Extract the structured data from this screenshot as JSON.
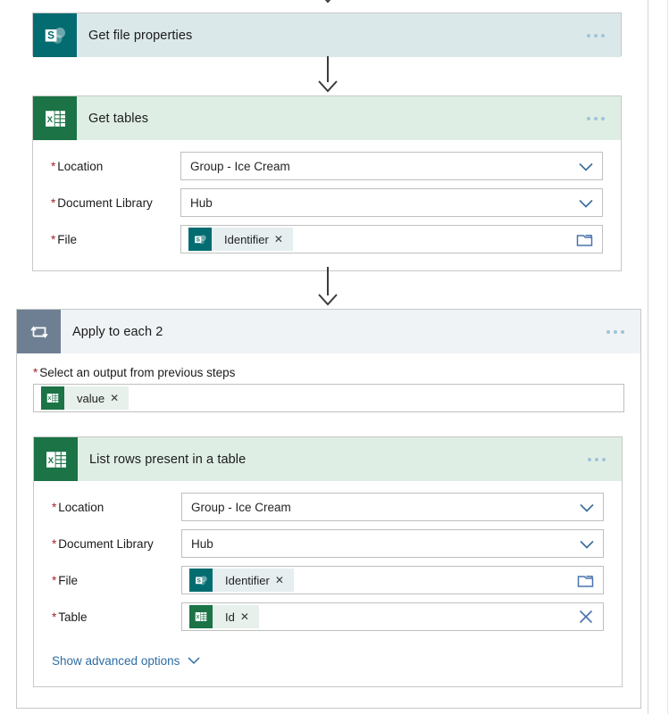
{
  "flow": {
    "steps": [
      {
        "id": "get-file-properties",
        "title": "Get file properties",
        "connector": "sharepoint",
        "icon": "sharepoint-icon",
        "menu_label": "...",
        "fields": []
      },
      {
        "id": "get-tables",
        "title": "Get tables",
        "connector": "excel",
        "icon": "excel-icon",
        "menu_label": "...",
        "fields": [
          {
            "label": "Location",
            "required": true,
            "type": "dropdown",
            "value": "Group - Ice Cream",
            "trailing_icon": "chevron-down-icon"
          },
          {
            "label": "Document Library",
            "required": true,
            "type": "dropdown",
            "value": "Hub",
            "trailing_icon": "chevron-down-icon"
          },
          {
            "label": "File",
            "required": true,
            "type": "token",
            "token": {
              "text": "Identifier",
              "icon": "sharepoint-icon",
              "remove_label": "✕"
            },
            "trailing_icon": "folder-picker-icon"
          }
        ]
      }
    ],
    "loop": {
      "id": "apply-to-each-2",
      "title": "Apply to each 2",
      "icon": "loop-icon",
      "menu_label": "...",
      "select_output_label": "Select an output from previous steps",
      "select_output_required": true,
      "select_output_token": {
        "text": "value",
        "icon": "excel-icon",
        "remove_label": "✕"
      },
      "inner_step": {
        "id": "list-rows-present-in-a-table",
        "title": "List rows present in a table",
        "connector": "excel",
        "icon": "excel-icon",
        "menu_label": "...",
        "fields": [
          {
            "label": "Location",
            "required": true,
            "type": "dropdown",
            "value": "Group - Ice Cream",
            "trailing_icon": "chevron-down-icon"
          },
          {
            "label": "Document Library",
            "required": true,
            "type": "dropdown",
            "value": "Hub",
            "trailing_icon": "chevron-down-icon"
          },
          {
            "label": "File",
            "required": true,
            "type": "token",
            "token": {
              "text": "Identifier",
              "icon": "sharepoint-icon",
              "remove_label": "✕"
            },
            "trailing_icon": "folder-picker-icon"
          },
          {
            "label": "Table",
            "required": true,
            "type": "token",
            "token": {
              "text": "Id",
              "icon": "excel-icon",
              "remove_label": "✕"
            },
            "trailing_icon": "clear-x-icon"
          }
        ],
        "advanced_options_label": "Show advanced options"
      }
    }
  },
  "colors": {
    "sharepoint_brand": "#036c70",
    "excel_brand": "#1b7346",
    "loop_brand": "#6f7f93",
    "sharepoint_header": "#dbe8ea",
    "excel_header": "#dfeee5",
    "loop_header": "#eff3f6",
    "required_star": "#a4262c",
    "link": "#2d6ca3",
    "arrow": "#3b3b3b",
    "border": "#c8c8c8"
  }
}
